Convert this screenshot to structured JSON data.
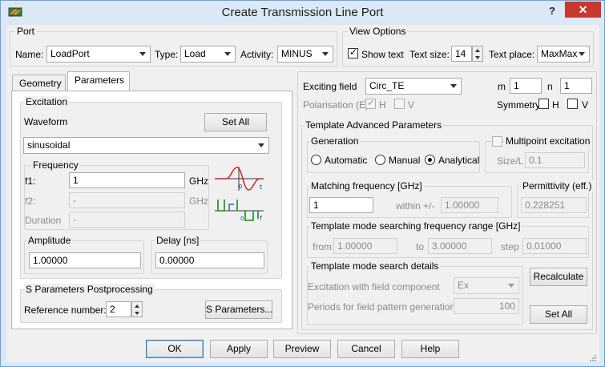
{
  "window": {
    "title": "Create Transmission Line Port",
    "help": "?",
    "close": "✕"
  },
  "port": {
    "group_label": "Port",
    "name_label": "Name:",
    "name_value": "LoadPort",
    "type_label": "Type:",
    "type_value": "Load",
    "activity_label": "Activity:",
    "activity_value": "MINUS"
  },
  "view_options": {
    "group_label": "View Options",
    "show_text_label": "Show text",
    "show_text_checked": true,
    "text_size_label": "Text size:",
    "text_size_value": "14",
    "text_place_label": "Text place:",
    "text_place_value": "MaxMax"
  },
  "tabs": [
    {
      "label": "Geometry"
    },
    {
      "label": "Parameters",
      "active": true
    }
  ],
  "excitation": {
    "group_label": "Excitation",
    "waveform_label": "Waveform",
    "set_all": "Set All",
    "waveform_value": "sinusoidal",
    "frequency_group": "Frequency",
    "f1_label": "f1:",
    "f1_value": "1",
    "f1_unit": "GHz",
    "f2_label": "f2:",
    "f2_value": "-",
    "f2_unit": "GHz",
    "duration_label": "Duration",
    "duration_value": "-",
    "amplitude_group": "Amplitude",
    "amplitude_value": "1.00000",
    "delay_group": "Delay [ns]",
    "delay_value": "0.00000",
    "waveform_icon_top": "waveform-sine-icon",
    "waveform_icon_bottom": "waveform-pulse-icon"
  },
  "s_params": {
    "group_label": "S Parameters Postprocessing",
    "ref_label": "Reference number:",
    "ref_value": "2",
    "button": "S Parameters..."
  },
  "exciting": {
    "field_label": "Exciting field",
    "field_value": "Circ_TE",
    "m_label": "m",
    "m_value": "1",
    "n_label": "n",
    "n_value": "1",
    "polarisation_label": "Polarisation (E)",
    "pol_h": "H",
    "pol_v": "V",
    "symmetry_label": "Symmetry",
    "sym_h": "H",
    "sym_v": "V"
  },
  "template": {
    "group_label": "Template Advanced Parameters",
    "generation_label": "Generation",
    "gen_automatic": "Automatic",
    "gen_manual": "Manual",
    "gen_analytical": "Analytical",
    "multipoint_label": "Multipoint excitation",
    "size_l_label": "Size/L",
    "size_l_value": "0.1",
    "match_freq_label": "Matching frequency [GHz]",
    "match_freq_value": "1",
    "within_label": "within +/-",
    "within_value": "1.00000",
    "permittivity_label": "Permittivity (eff.)",
    "permittivity_value": "0.228251",
    "range_label": "Template mode searching frequency range [GHz]",
    "from_label": "from",
    "from_value": "1.00000",
    "to_label": "to",
    "to_value": "3.00000",
    "step_label": "step",
    "step_value": "0.01000",
    "search_label": "Template mode search details",
    "excitation_comp_label": "Excitation with field component",
    "excitation_comp_value": "Ex",
    "periods_label": "Periods for field pattern generation",
    "periods_value": "100",
    "recalculate": "Recalculate",
    "set_all": "Set All"
  },
  "footer": {
    "ok": "OK",
    "apply": "Apply",
    "preview": "Preview",
    "cancel": "Cancel",
    "help": "Help"
  },
  "colors": {
    "title_bg": "#dbe8f5",
    "close_bg": "#c7392d",
    "accent": "#3c7fb1"
  }
}
